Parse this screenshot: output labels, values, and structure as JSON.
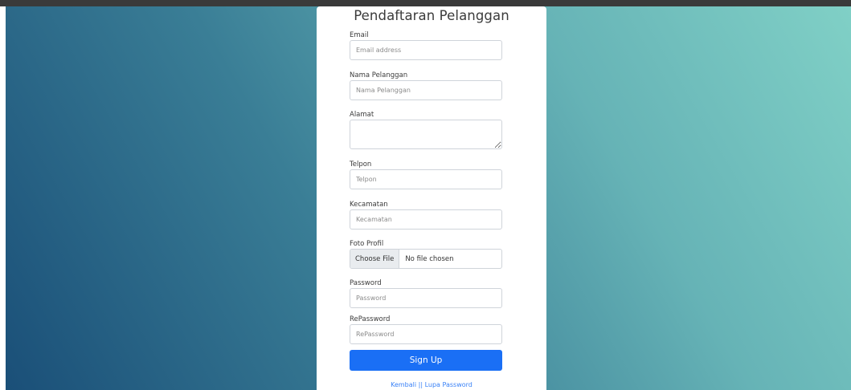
{
  "page": {
    "title": "Pendaftaran Pelanggan"
  },
  "form": {
    "email": {
      "label": "Email",
      "placeholder": "Email address",
      "value": ""
    },
    "nama": {
      "label": "Nama Pelanggan",
      "placeholder": "Nama Pelanggan",
      "value": ""
    },
    "alamat": {
      "label": "Alamat",
      "placeholder": "",
      "value": ""
    },
    "telpon": {
      "label": "Telpon",
      "placeholder": "Telpon",
      "value": ""
    },
    "kecamatan": {
      "label": "Kecamatan",
      "placeholder": "Kecamatan",
      "value": ""
    },
    "foto": {
      "label": "Foto Profil",
      "button_label": "Choose File",
      "status": "No file chosen"
    },
    "password": {
      "label": "Password",
      "placeholder": "Password",
      "value": ""
    },
    "repassword": {
      "label": "RePassword",
      "placeholder": "RePassword",
      "value": ""
    },
    "submit_label": "Sign Up"
  },
  "footer": {
    "back_label": "Kembali",
    "separator": "||",
    "forgot_label": "Lupa Password"
  },
  "colors": {
    "primary_button": "#1a6ff5",
    "link": "#3a82f7",
    "background_start": "#1a4f78",
    "background_end": "#80d0c6"
  }
}
